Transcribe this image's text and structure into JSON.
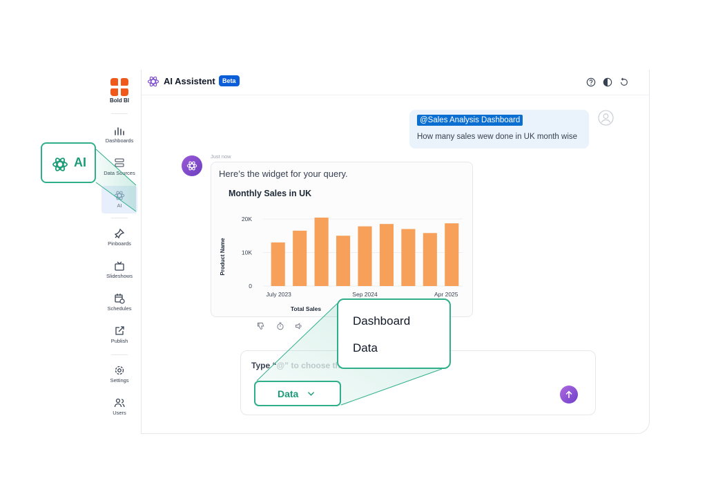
{
  "sidebar": {
    "brand": "Bold BI",
    "items": [
      {
        "label": "Dashboards"
      },
      {
        "label": "Data Sources"
      },
      {
        "label": "AI"
      },
      {
        "label": "Pinboards"
      },
      {
        "label": "Slideshows"
      },
      {
        "label": "Schedules"
      },
      {
        "label": "Publish"
      },
      {
        "label": "Settings"
      },
      {
        "label": "Users"
      }
    ]
  },
  "header": {
    "title": "AI Assistent",
    "badge": "Beta",
    "icons": [
      "help-icon",
      "theme-icon",
      "reset-icon"
    ]
  },
  "conversation": {
    "user_mention": "@Sales Analysis Dashboard",
    "user_message": "How many sales wew done in UK month wise",
    "timestamp": "Just now",
    "bot_message": "Here’s the widget for your query."
  },
  "chart_data": {
    "type": "bar",
    "title": "Monthly Sales in UK",
    "xlabel": "Total Sales",
    "ylabel": "Product Name",
    "x_tick_labels": [
      "July 2023",
      "Sep 2024",
      "Apr 2025"
    ],
    "y_tick_labels": [
      "20K",
      "10K",
      "0"
    ],
    "ylim": [
      0,
      20000
    ],
    "values": [
      13000,
      16500,
      20400,
      15000,
      17800,
      18500,
      17000,
      15800,
      18700
    ],
    "bar_color": "#f6a05a"
  },
  "composer": {
    "placeholder_start": "Type “",
    "placeholder_rest": "@” to choose th",
    "send_label": "Send"
  },
  "callouts": {
    "ai_label": "AI",
    "menu_items": [
      "Dashboard",
      "Data"
    ],
    "select_value": "Data"
  },
  "colors": {
    "accent_green": "#2fae8a",
    "brand_orange": "#ef5a1c",
    "mention_blue": "#0b6fd1",
    "bubble_bg": "#eaf3fb"
  }
}
